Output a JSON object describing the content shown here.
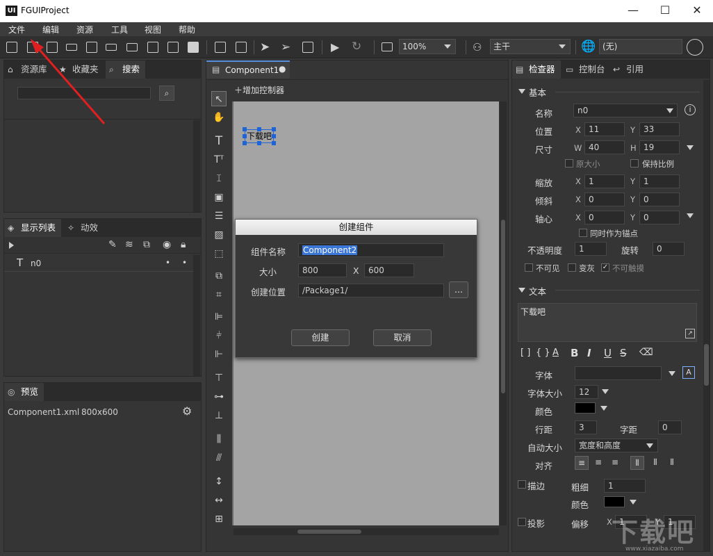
{
  "window": {
    "title": "FGUIProject",
    "logo": "UI",
    "controls": [
      "—",
      "☐",
      "✕"
    ]
  },
  "menu": [
    "文件",
    "编辑",
    "资源",
    "工具",
    "视图",
    "帮助"
  ],
  "toolbar": {
    "zoom": "100%",
    "branch": "主干",
    "lang": "(无)"
  },
  "left": {
    "tabs": [
      "资源库",
      "收藏夹",
      "搜索"
    ],
    "display_tabs": [
      "显示列表",
      "动效"
    ],
    "display_item": "n0",
    "preview_tab": "预览",
    "preview_file": "Component1.xml",
    "preview_size": "800x600"
  },
  "center": {
    "doc_tab": "Component1",
    "add_controller": "增加控制器",
    "canvas_text": "下载吧"
  },
  "dialog": {
    "title": "创建组件",
    "name_label": "组件名称",
    "name_value": "Component2",
    "size_label": "大小",
    "width": "800",
    "x_sep": "X",
    "height": "600",
    "location_label": "创建位置",
    "location_value": "/Package1/",
    "browse": "...",
    "create": "创建",
    "cancel": "取消"
  },
  "inspector": {
    "tabs": [
      "检查器",
      "控制台",
      "引用"
    ],
    "basic": "基本",
    "name_label": "名称",
    "name_value": "n0",
    "pos_label": "位置",
    "x": "11",
    "y": "33",
    "size_label": "尺寸",
    "w": "40",
    "h": "19",
    "orig_size": "原大小",
    "keep_ratio": "保持比例",
    "scale_label": "缩放",
    "sx": "1",
    "sy": "1",
    "skew_label": "倾斜",
    "kx": "0",
    "ky": "0",
    "pivot_label": "轴心",
    "px": "0",
    "py": "0",
    "as_anchor": "同时作为锚点",
    "opacity_label": "不透明度",
    "opacity": "1",
    "rotation_label": "旋转",
    "rotation": "0",
    "invisible": "不可见",
    "grayed": "变灰",
    "untouchable": "不可触摸",
    "text_section": "文本",
    "text_value": "下载吧",
    "font_label": "字体",
    "font_size_label": "字体大小",
    "font_size": "12",
    "color_label": "颜色",
    "line_spacing_label": "行距",
    "line_spacing": "3",
    "letter_spacing_label": "字距",
    "letter_spacing": "0",
    "auto_size_label": "自动大小",
    "auto_size": "宽度和高度",
    "align_label": "对齐",
    "stroke_label": "描边",
    "stroke_width_label": "粗细",
    "stroke_width": "1",
    "stroke_color_label": "颜色",
    "shadow_label": "投影",
    "offset_label": "偏移",
    "offset_x": "1",
    "offset_y": "1",
    "axis_x": "X",
    "axis_y": "Y",
    "axis_w": "W",
    "axis_h": "H"
  },
  "watermark": {
    "big": "下载吧",
    "url": "www.xiazaiba.com"
  },
  "colors": {
    "accent": "#1e64d8",
    "selection": "#3a76d6"
  }
}
